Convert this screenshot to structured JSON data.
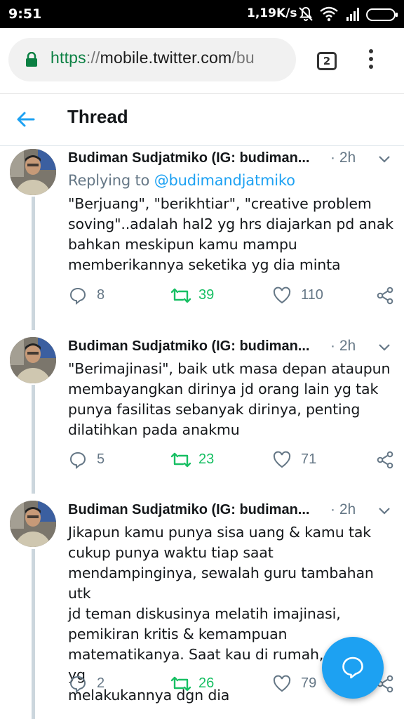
{
  "status_bar": {
    "time": "9:51",
    "network_speed": "1,19K/s",
    "icons": [
      "bell-off-icon",
      "wifi-icon",
      "signal-icon",
      "battery-icon"
    ]
  },
  "browser": {
    "url_scheme": "https",
    "url_separator": "://",
    "url_host": "mobile.twitter.com",
    "url_path": "/bu",
    "tab_count": "2"
  },
  "header": {
    "title": "Thread"
  },
  "colors": {
    "accent": "#1da1f2",
    "retweet": "#17bf63",
    "secondary_text": "#657786",
    "thread_line": "#ccd6dd"
  },
  "tweets": [
    {
      "author": "Budiman Sudjatmiko (IG: budiman...",
      "time": "· 2h",
      "replying_prefix": "Replying to",
      "replying_handle": "@budimandjatmiko",
      "lines": [
        "\"Berjuang\", \"berikhtiar\", \"creative problem",
        "soving\"..adalah hal2 yg hrs diajarkan pd anak",
        "bahkan meskipun kamu mampu",
        "memberikannya seketika yg dia minta"
      ],
      "replies": "8",
      "retweets": "39",
      "likes": "110"
    },
    {
      "author": "Budiman Sudjatmiko (IG: budiman...",
      "time": "· 2h",
      "lines": [
        "\"Berimajinasi\", baik utk masa depan ataupun",
        "membayangkan dirinya jd orang lain yg tak",
        "punya fasilitas sebanyak dirinya, penting",
        "dilatihkan pada anakmu"
      ],
      "replies": "5",
      "retweets": "23",
      "likes": "71"
    },
    {
      "author": "Budiman Sudjatmiko (IG: budiman...",
      "time": "· 2h",
      "lines": [
        "Jikapun kamu punya sisa uang & kamu tak",
        "cukup punya waktu tiap saat",
        "mendampinginya, sewalah guru tambahan utk",
        "jd teman diskusinya melatih imajinasi,",
        "pemikiran kritis & kemampuan",
        "matematikanya. Saat kau di rumah, kau lah yg",
        "melakukannya dgn dia"
      ],
      "replies": "2",
      "retweets": "26",
      "likes": "79"
    }
  ]
}
